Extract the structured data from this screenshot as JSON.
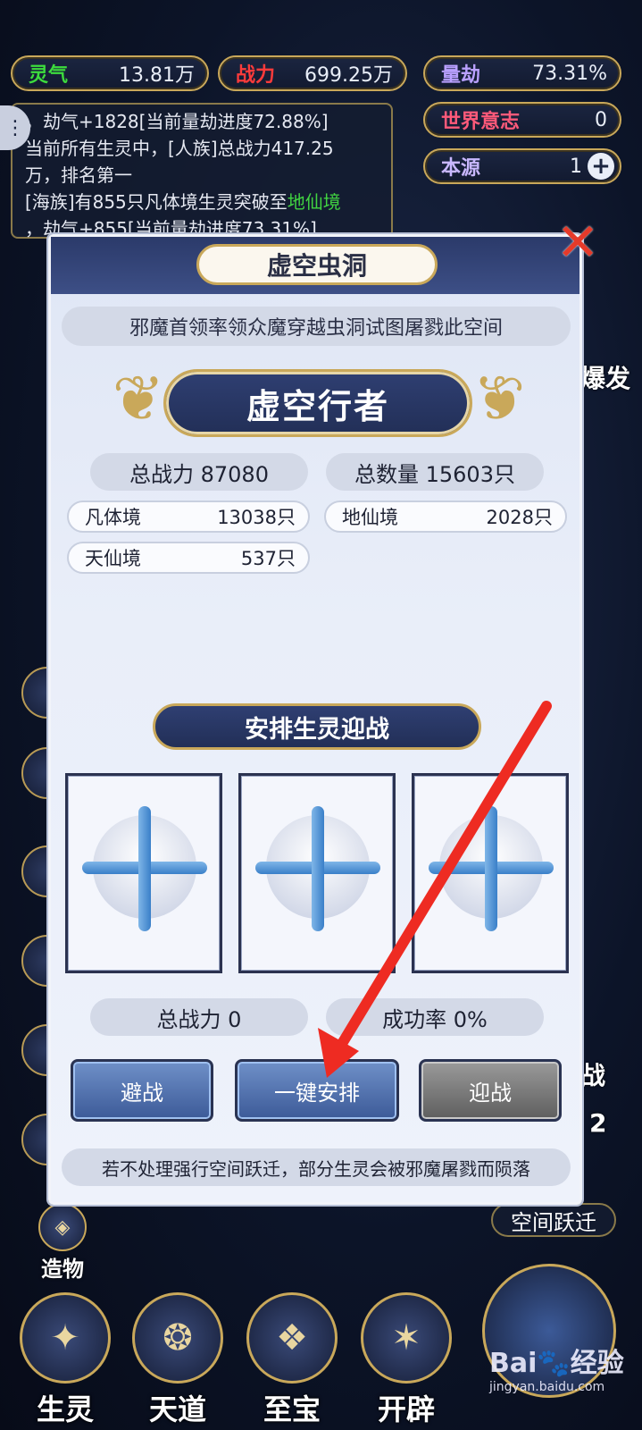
{
  "top_bar": {
    "lingqi": {
      "label": "灵气",
      "value": "13.81万",
      "color": "#3ddc3d"
    },
    "zhanli": {
      "label": "战力",
      "value": "699.25万",
      "color": "#ff3b3b"
    },
    "liangjie": {
      "label": "量劫",
      "value": "73.31%",
      "color": "#b9a0ff"
    },
    "shijie": {
      "label": "世界意志",
      "value": "0",
      "color": "#ff5a7a"
    },
    "benyuan": {
      "label": "本源",
      "value": "1",
      "color": "#c9b8ff"
    }
  },
  "log": {
    "line1": "，劫气+1828[当前量劫进度72.88%]",
    "line2": "当前所有生灵中，[人族]总战力417.25",
    "line3": "万，排名第一",
    "line4a": "[海族]有855只凡体境生灵突破至",
    "line4b": "地仙境",
    "line5": "，劫气+855[当前量劫进度73.31%]"
  },
  "side": {
    "right_text": "爆发",
    "space_jump": "空间跃迁",
    "create": "造物",
    "battle": "战",
    "num": "2"
  },
  "dialog": {
    "title": "虚空虫洞",
    "subtitle": "邪魔首领率领众魔穿越虫洞试图屠戮此空间",
    "enemy": "虚空行者",
    "total_power_label": "总战力 87080",
    "total_count_label": "总数量 15603只",
    "realms": [
      {
        "name": "凡体境",
        "count": "13038只"
      },
      {
        "name": "地仙境",
        "count": "2028只"
      },
      {
        "name": "天仙境",
        "count": "537只"
      }
    ],
    "section_title": "安排生灵迎战",
    "our_power": "总战力 0",
    "success_rate": "成功率 0%",
    "buttons": {
      "avoid": "避战",
      "auto": "一键安排",
      "fight": "迎战"
    },
    "footer": "若不处理强行空间跃迁，部分生灵会被邪魔屠戮而陨落"
  },
  "nav": [
    {
      "label": "生灵"
    },
    {
      "label": "天道"
    },
    {
      "label": "至宝"
    },
    {
      "label": "开辟"
    }
  ],
  "watermark": {
    "brand": "Bai",
    "sub": "jingyan.baidu.com",
    "text": "经验"
  }
}
